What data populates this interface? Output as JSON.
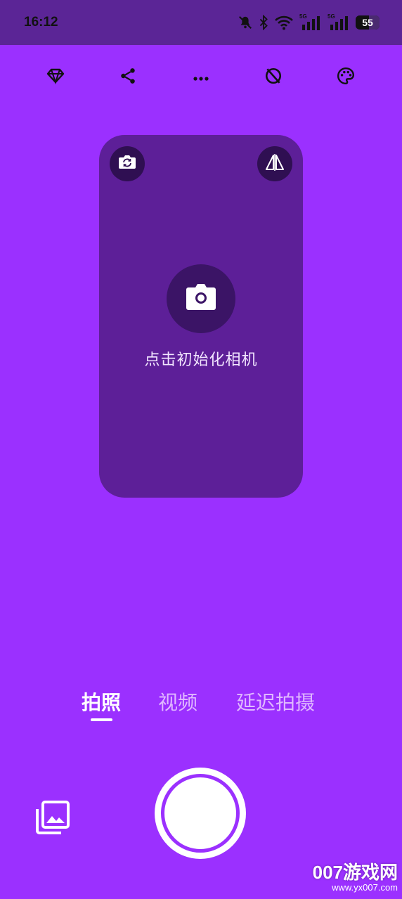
{
  "status_bar": {
    "time": "16:12",
    "network_1": "5G",
    "network_2": "5G",
    "battery": "55"
  },
  "toolbar": {
    "icons": [
      "diamond-icon",
      "share-icon",
      "more-icon",
      "timer-off-icon",
      "palette-icon"
    ]
  },
  "preview": {
    "init_label": "点击初始化相机"
  },
  "mode_tabs": [
    {
      "label": "拍照",
      "active": true
    },
    {
      "label": "视频",
      "active": false
    },
    {
      "label": "延迟拍摄",
      "active": false
    }
  ],
  "watermark": {
    "main": "007游戏网",
    "sub": "www.yx007.com"
  },
  "colors": {
    "background": "#9b30ff",
    "status_bar": "#5b2596",
    "preview": "#5d1f98",
    "button_dark": "#2f0f52"
  }
}
